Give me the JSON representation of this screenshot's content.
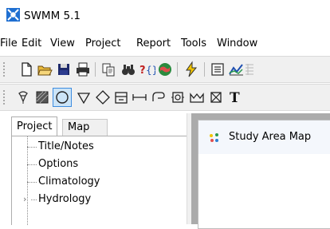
{
  "window": {
    "title": "SWMM 5.1"
  },
  "menu": [
    "File",
    "Edit",
    "View",
    "Project",
    "Report",
    "Tools",
    "Window"
  ],
  "toolbar1": [
    "new-file-icon",
    "open-folder-icon",
    "save-icon",
    "print-icon",
    "copy-icon",
    "find-icon",
    "query-icon",
    "map-legend-icon",
    "run-icon",
    "report-icon",
    "graph-icon"
  ],
  "toolbar2": [
    "rain-gage-icon",
    "subcatchment-icon",
    "junction-icon",
    "outfall-icon",
    "divider-icon",
    "storage-icon",
    "conduit-icon",
    "pump-icon",
    "orifice-icon",
    "weir-icon",
    "outlet-icon",
    "label-icon"
  ],
  "toolbar2_label_glyph": "T",
  "panel": {
    "tabs": [
      "Project",
      "Map"
    ],
    "active_tab": "Project",
    "tree": [
      "Title/Notes",
      "Options",
      "Climatology",
      "Hydrology"
    ],
    "expandable": "Hydrology"
  },
  "map_window": {
    "title": "Study Area Map"
  },
  "colors": {
    "accent": "#3e8de0",
    "mdi_background": "#ababab",
    "select_fill": "#cce4f7"
  }
}
